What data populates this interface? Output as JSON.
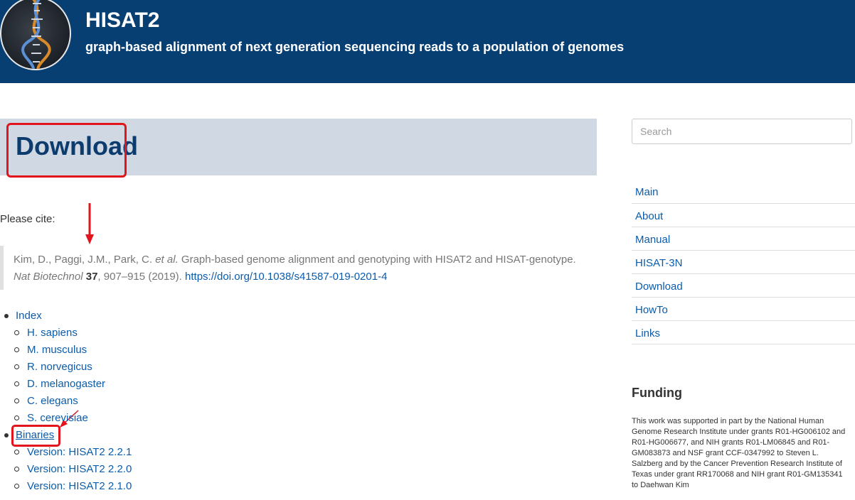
{
  "header": {
    "title": "HISAT2",
    "subtitle": "graph-based alignment of next generation sequencing reads to a population of genomes"
  },
  "page": {
    "title": "Download"
  },
  "citation": {
    "label": "Please cite:",
    "authors": "Kim, D., Paggi, J.M., Park, C.",
    "et_al": "et al.",
    "title": "Graph-based genome alignment and genotyping with HISAT2 and HISAT-genotype.",
    "journal": "Nat Biotechnol",
    "volume": "37",
    "pages_year": ", 907–915 (2019).",
    "doi": "https://doi.org/10.1038/s41587-019-0201-4"
  },
  "list": {
    "index_label": "Index",
    "index_items": [
      "H. sapiens",
      "M. musculus",
      "R. norvegicus",
      "D. melanogaster",
      "C. elegans",
      "S. cerevisiae"
    ],
    "binaries_label": "Binaries",
    "binaries_items": [
      "Version: HISAT2 2.2.1",
      "Version: HISAT2 2.2.0",
      "Version: HISAT2 2.1.0"
    ]
  },
  "sidebar": {
    "search_placeholder": "Search",
    "nav": [
      "Main",
      "About",
      "Manual",
      "HISAT-3N",
      "Download",
      "HowTo",
      "Links"
    ],
    "funding_title": "Funding",
    "funding_text": "This work was supported in part by the National Human Genome Research Institute under grants R01-HG006102 and R01-HG006677, and NIH grants R01-LM06845 and R01-GM083873 and NSF grant CCF-0347992 to Steven L. Salzberg and by the Cancer Prevention Research Institute of Texas under grant RR170068 and NIH grant R01-GM135341 to Daehwan Kim"
  },
  "colors": {
    "header_bg": "#083f72",
    "title_band_bg": "#cfd8e3",
    "link": "#0b5cad",
    "annotation_red": "#e2141c"
  },
  "icons": {
    "logo": "dna-helix-logo"
  }
}
